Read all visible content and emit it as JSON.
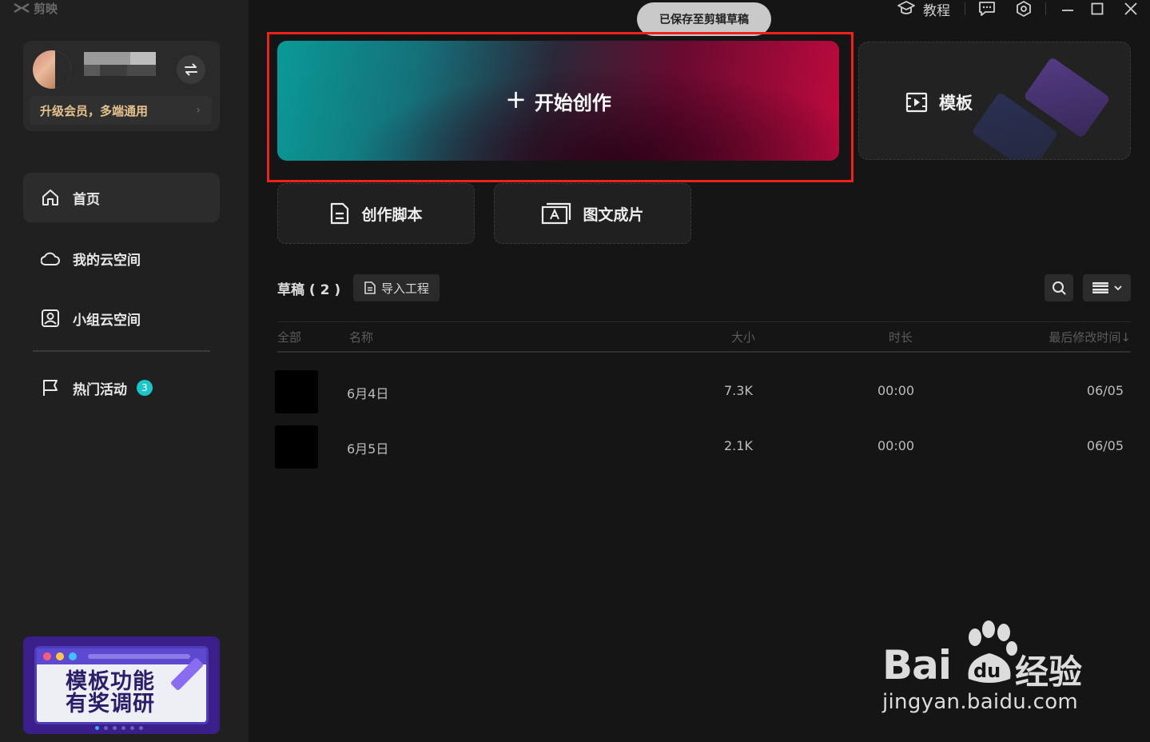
{
  "app": {
    "logo_text": "剪映"
  },
  "user": {
    "vip_text": "升级会员，多端通用"
  },
  "sidebar": {
    "items": [
      {
        "label": "首页",
        "icon": "home-icon",
        "active": true
      },
      {
        "label": "我的云空间",
        "icon": "cloud-icon",
        "active": false
      },
      {
        "label": "小组云空间",
        "icon": "group-space-icon",
        "active": false
      },
      {
        "label": "热门活动",
        "icon": "flag-icon",
        "active": false,
        "badge": "3"
      }
    ]
  },
  "promo": {
    "text_line1": "模板功能",
    "text_line2": "有奖调研"
  },
  "topbar": {
    "saved_toast": "已保存至剪辑草稿",
    "tutorial_label": "教程"
  },
  "main": {
    "create_label": "开始创作",
    "template_label": "模板",
    "script_label": "创作脚本",
    "image_text_label": "图文成片"
  },
  "drafts": {
    "title": "草稿 ( 2 )",
    "import_label": "导入工程",
    "columns": {
      "all": "全部",
      "name": "名称",
      "size": "大小",
      "duration": "时长",
      "modified": "最后修改时间↓"
    },
    "rows": [
      {
        "name": "6月4日",
        "size": "7.3K",
        "duration": "00:00",
        "modified": "06/05"
      },
      {
        "name": "6月5日",
        "size": "2.1K",
        "duration": "00:00",
        "modified": "06/05"
      }
    ]
  },
  "watermark": {
    "brand": "Bai",
    "brand_suffix": "经验",
    "url": "jingyan.baidu.com"
  },
  "colors": {
    "accent_badge": "#1bc6c8",
    "highlight_border": "#f0201a",
    "vip_gold": "#e5c28e"
  }
}
